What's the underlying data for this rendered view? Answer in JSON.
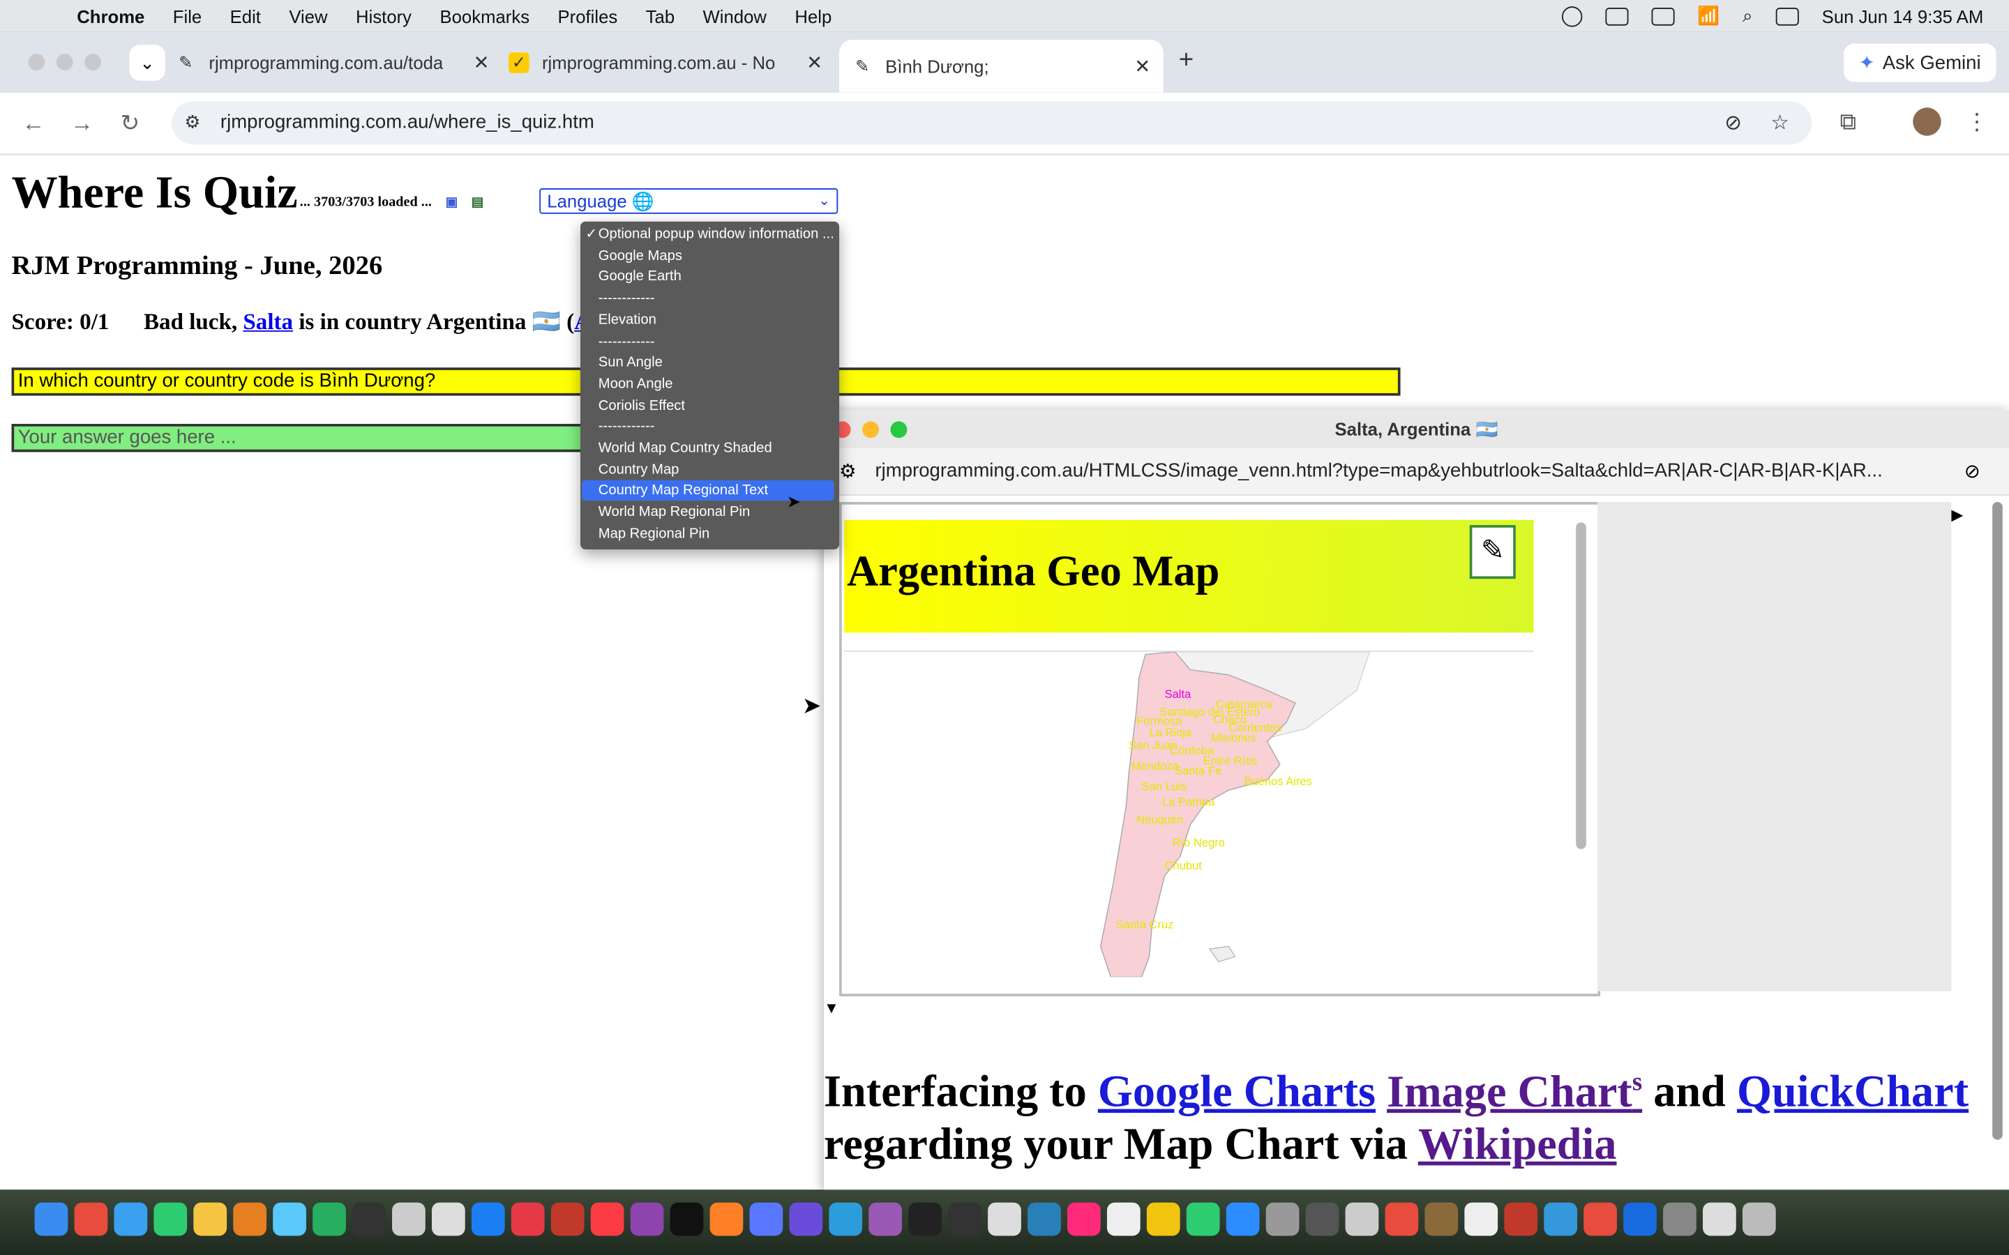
{
  "menubar": {
    "apple": "",
    "items": [
      "Chrome",
      "File",
      "Edit",
      "View",
      "History",
      "Bookmarks",
      "Profiles",
      "Tab",
      "Window",
      "Help"
    ],
    "datetime": "Sun Jun 14  9:35 AM"
  },
  "tabs": [
    {
      "title": "rjmprogramming.com.au/toda",
      "close": "✕"
    },
    {
      "title": "rjmprogramming.com.au - No",
      "close": "✕"
    },
    {
      "title": "Bình Dương;",
      "close": "✕"
    }
  ],
  "newtab": "+",
  "gemini": "Ask Gemini",
  "address": {
    "url": "rjmprogramming.com.au/where_is_quiz.htm"
  },
  "page": {
    "title": "Where Is Quiz",
    "loaded": "... 3703/3703 loaded ...",
    "subtitle": "RJM Programming - June, 2026",
    "score_prefix": "Score: 0/1      Bad luck, ",
    "score_link": "Salta",
    "score_mid": " is in country Argentina 🇦🇷 (",
    "score_code": "AR",
    "score_end": ")",
    "language_label": "Language 🌐",
    "question": "In which country or country code is Bình Dương?",
    "answer_placeholder": "Your answer goes here ..."
  },
  "dropdown": {
    "items": [
      {
        "label": "Optional popup window information ...",
        "checked": true
      },
      {
        "label": "Google Maps"
      },
      {
        "label": "Google Earth"
      },
      {
        "label": "------------"
      },
      {
        "label": "Elevation"
      },
      {
        "label": "------------"
      },
      {
        "label": "Sun Angle"
      },
      {
        "label": "Moon Angle"
      },
      {
        "label": "Coriolis Effect"
      },
      {
        "label": "------------"
      },
      {
        "label": "World Map Country Shaded"
      },
      {
        "label": "Country Map"
      },
      {
        "label": "Country Map Regional Text",
        "selected": true
      },
      {
        "label": "World Map Regional Pin"
      },
      {
        "label": "Map Regional Pin"
      }
    ]
  },
  "popup": {
    "title": "Salta, Argentina 🇦🇷",
    "url": "rjmprogramming.com.au/HTMLCSS/image_venn.html?type=map&yehbutrlook=Salta&chld=AR|AR-C|AR-B|AR-K|AR...",
    "map_title": "Argentina Geo Map",
    "highlight_label": "Salta",
    "region_labels": [
      "Santiago del Estero",
      "Catamarca",
      "Formosa",
      "Chaco",
      "La Rioja",
      "Corrientes",
      "San Juan",
      "Córdoba",
      "Misiones",
      "Santa Fe",
      "Entre Ríos",
      "Mendoza",
      "San Luis",
      "Buenos Aires",
      "La Pampa",
      "Neuquén",
      "Río Negro",
      "Chubut",
      "Santa Cruz"
    ],
    "interfacing_prefix": "Interfacing to ",
    "link_google": "Google Charts",
    "link_image": "Image Chart",
    "link_image_sup": "s",
    "and": " and ",
    "link_quick": "QuickChart",
    "regarding": "regarding your Map Chart via ",
    "link_wiki": "Wikipedia"
  }
}
